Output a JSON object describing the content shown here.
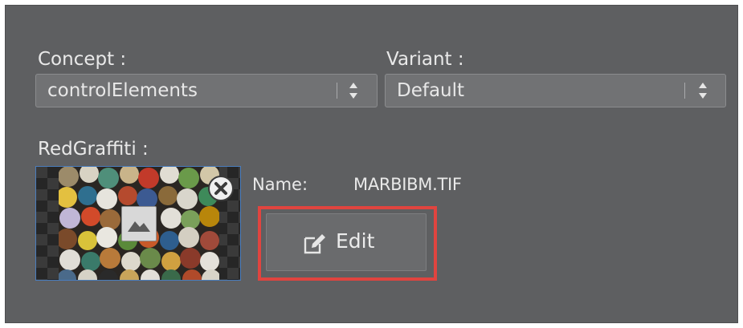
{
  "concept": {
    "label": "Concept :",
    "selected": "controlElements"
  },
  "variant": {
    "label": "Variant :",
    "selected": "Default"
  },
  "texture": {
    "label": "RedGraffiti :",
    "name_label": "Name:",
    "name_value": "MARBIBM.TIF"
  },
  "actions": {
    "edit_label": "Edit"
  },
  "icons": {
    "select_arrows": "up-down-arrows-icon",
    "remove": "close-circle-icon",
    "placeholder": "image-placeholder-icon",
    "edit": "edit-pencil-icon"
  },
  "colors": {
    "panel_bg": "#5e5f61",
    "select_bg": "#717274",
    "thumb_border": "#4a7dbd",
    "highlight": "#e0443f"
  }
}
